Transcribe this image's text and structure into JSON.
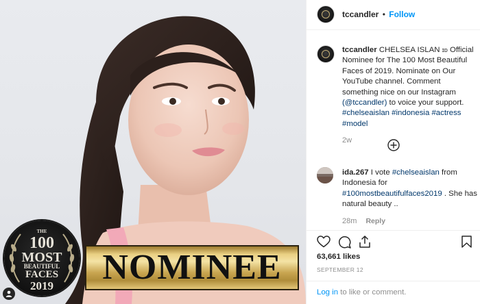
{
  "post": {
    "username": "tccandler",
    "follow_label": "Follow",
    "separator": "•",
    "photo": {
      "banner_text": "NOMINEE",
      "seal": {
        "the": "THE",
        "number": "100",
        "most": "MOST",
        "beautiful": "BEAUTIFUL",
        "faces": "FACES",
        "year": "2019"
      }
    },
    "caption": {
      "username": "tccandler",
      "line1_text": "CHELSEA ISLAN ",
      "line1_small": "ɪᴅ",
      "line1_end": " Official",
      "line2": "Nominee for The 100 Most Beautiful",
      "line3": "Faces of 2019. Nominate on Our",
      "line4": "YouTube channel. Comment",
      "line5": "something nice on our Instagram",
      "line6_mention": "(@tccandler)",
      "line6_rest": " to voice your support.",
      "line7": "#chelseaislan #indonesia #actress",
      "line8": "#model",
      "time": "2w"
    },
    "load_more_icon": "plus-circle-icon",
    "comment": {
      "username": "ida.267",
      "line1_text": " I vote ",
      "line1_tag": "#chelseaislan",
      "line1_end": " from",
      "line2": "Indonesia for",
      "line3_tag": "#100mostbeautifulfaces2019",
      "line3_end": " . She has",
      "line4": "natural beauty ..",
      "time": "28m",
      "reply_label": "Reply"
    },
    "actions": {
      "like_icon": "heart-icon",
      "comment_icon": "comment-icon",
      "share_icon": "share-icon",
      "save_icon": "bookmark-icon"
    },
    "likes": "63,661 likes",
    "date": "SEPTEMBER 12",
    "login_prompt": {
      "link": "Log in",
      "rest": " to like or comment."
    },
    "profile_icon": "profile-icon"
  }
}
